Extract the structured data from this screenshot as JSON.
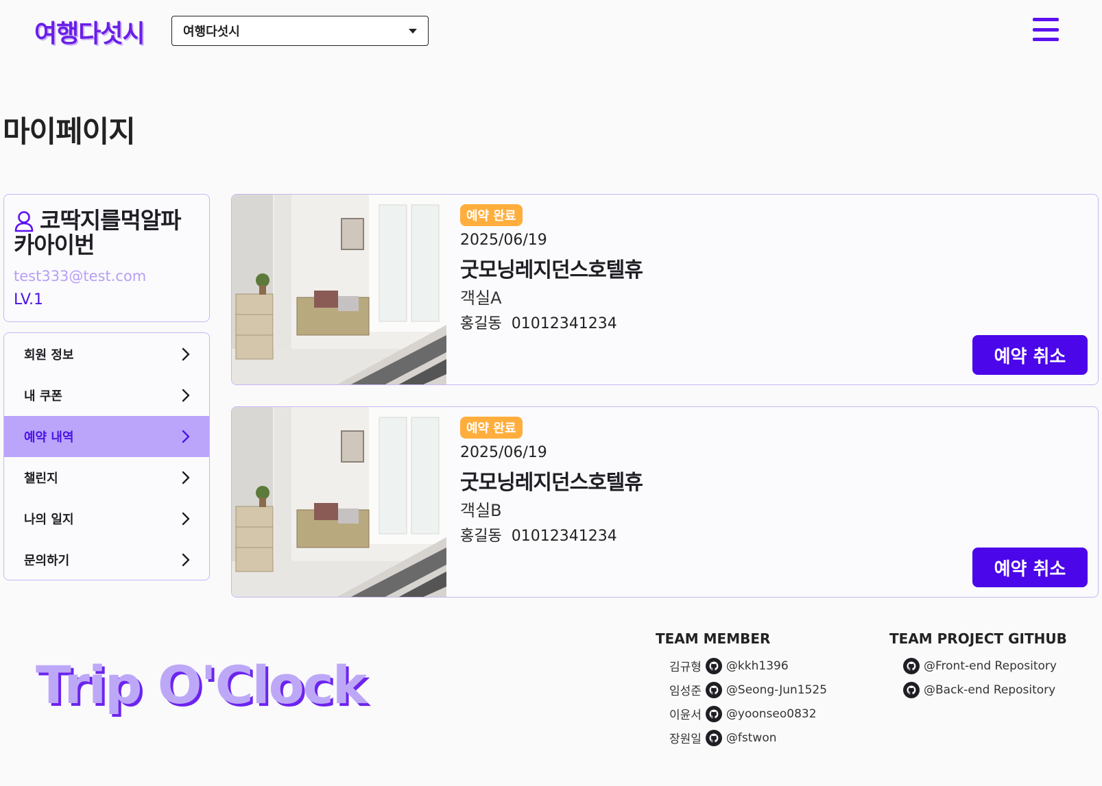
{
  "header": {
    "logo": "여행다섯시",
    "region_select_value": "여행다섯시"
  },
  "page_title": "마이페이지",
  "profile": {
    "name_line1": "코딱지를먹알파",
    "name_line2": "카아이번",
    "email": "test333@test.com",
    "level": "LV.1"
  },
  "side_menu": [
    {
      "label": "회원 정보"
    },
    {
      "label": "내 쿠폰"
    },
    {
      "label": "예약 내역"
    },
    {
      "label": "챌린지"
    },
    {
      "label": "나의 일지"
    },
    {
      "label": "문의하기"
    }
  ],
  "reservations": [
    {
      "status": "예약 완료",
      "date": "2025/06/19",
      "hotel": "굿모닝레지던스호텔휴",
      "room": "객실A",
      "guest_name": "홍길동",
      "guest_phone": "01012341234",
      "cancel_label": "예약 취소"
    },
    {
      "status": "예약 완료",
      "date": "2025/06/19",
      "hotel": "굿모닝레지던스호텔휴",
      "room": "객실B",
      "guest_name": "홍길동",
      "guest_phone": "01012341234",
      "cancel_label": "예약 취소"
    }
  ],
  "footer": {
    "logo": "Trip O'Clock",
    "team_member_title": "TEAM MEMBER",
    "members": [
      {
        "name": "김규형",
        "github": "@kkh1396"
      },
      {
        "name": "임성준",
        "github": "@Seong-Jun1525"
      },
      {
        "name": "이윤서",
        "github": "@yoonseo0832"
      },
      {
        "name": "장원일",
        "github": "@fstwon"
      }
    ],
    "github_title": "TEAM PROJECT GITHUB",
    "repos": [
      {
        "label": "@Front-end Repository"
      },
      {
        "label": "@Back-end Repository"
      }
    ]
  },
  "colors": {
    "accent": "#4b06ea",
    "accent_light": "#bba5fb",
    "border": "#c8b6f5",
    "badge": "#ffae3d"
  },
  "icons": {
    "menu": "hamburger-menu-icon",
    "user": "user-icon",
    "chevron": "chevron-right-icon",
    "github": "github-icon",
    "dropdown": "caret-down-icon"
  }
}
